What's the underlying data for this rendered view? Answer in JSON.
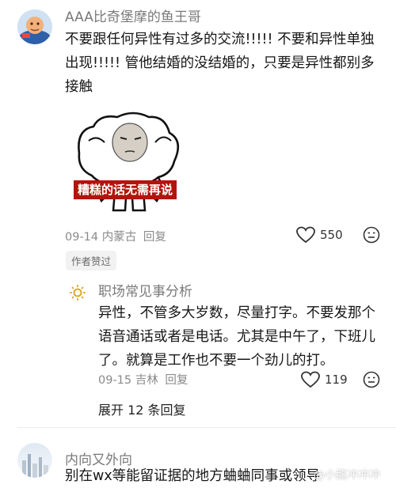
{
  "comment1": {
    "username": "AAA比奇堡摩的鱼王哥",
    "text": "不要跟任何异性有过多的交流!!!!! 不要和异性单独出现!!!!! 管他结婚的没结婚的，只要是异性都别多接触",
    "sticker_caption": "糟糕的话无需再说",
    "date": "09-14",
    "location": "内蒙古",
    "reply_label": "回复",
    "like_count": "550",
    "author_badge": "作者赞过"
  },
  "reply1": {
    "username": "职场常见事分析",
    "text": "异性，不管多大岁数，尽量打字。不要发那个语音通话或者是电话。尤其是中午了，下班儿了。就算是工作也不要一个劲儿的打。",
    "date": "09-15",
    "location": "吉林",
    "reply_label": "回复",
    "like_count": "119"
  },
  "expand_replies": "展开 12 条回复",
  "comment2": {
    "username": "内向又外向",
    "text": "别在wx等能留证据的地方蛐蛐同事或领导"
  },
  "watermark": "@小龍冲冲冲",
  "icons": [
    "heart-icon",
    "reaction-face-icon",
    "sun-avatar-icon",
    "city-avatar-icon"
  ],
  "colors": {
    "username": "#7a7a7a",
    "sticker_caption_bg": "#b3140c",
    "badge_bg": "#f2f2f2"
  }
}
